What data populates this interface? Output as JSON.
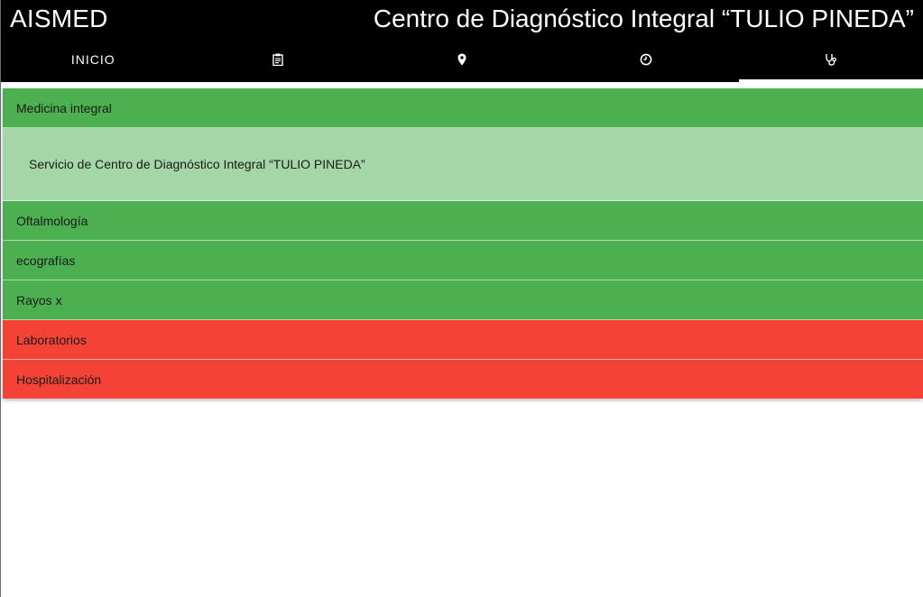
{
  "header": {
    "brand": "AISMED",
    "title": "Centro de Diagnóstico Integral “TULIO PINEDA”"
  },
  "tabs": [
    {
      "label": "INICIO",
      "icon": "home"
    },
    {
      "label": "",
      "icon": "clipboard-icon"
    },
    {
      "label": "",
      "icon": "map-pin-icon"
    },
    {
      "label": "",
      "icon": "clock-icon"
    },
    {
      "label": "",
      "icon": "stethoscope-icon",
      "active": true
    }
  ],
  "services": {
    "items": [
      {
        "label": "Medicina integral",
        "status": "green",
        "expanded": true,
        "detail": "Servicio de Centro de Diagnóstico Integral “TULIO PINEDA”"
      },
      {
        "label": "Oftalmología",
        "status": "green"
      },
      {
        "label": "ecografías",
        "status": "green"
      },
      {
        "label": "Rayos x",
        "status": "green"
      },
      {
        "label": "Laboratorios",
        "status": "red"
      },
      {
        "label": "Hospitalización",
        "status": "red"
      }
    ]
  },
  "colors": {
    "available": "#4caf50",
    "available_light": "#a5d6a7",
    "unavailable": "#f44336",
    "header": "#000000"
  }
}
